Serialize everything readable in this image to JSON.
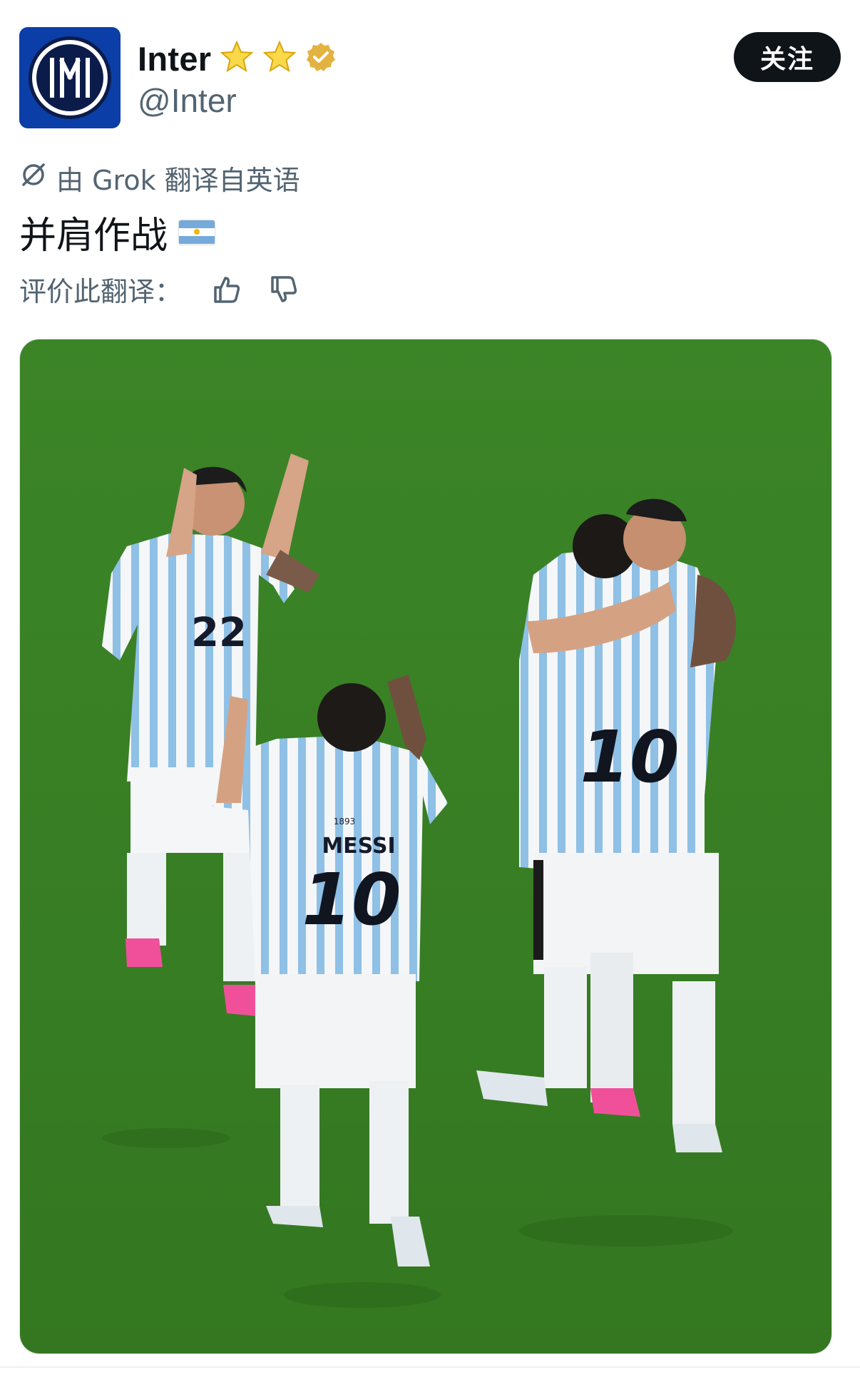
{
  "account": {
    "display_name": "Inter",
    "handle": "@Inter",
    "logo_letters": "IM",
    "badges": [
      "star-icon",
      "star-icon",
      "verified-badge-icon"
    ]
  },
  "follow_button": {
    "label": "关注"
  },
  "translation": {
    "label": "由 Grok 翻译自英语",
    "post_text": "并肩作战",
    "flag_emoji": "argentina-flag-icon",
    "rate_label": "评价此翻译："
  },
  "media": {
    "description_icon": "photo",
    "jersey_left": "22",
    "jersey_center_name": "MESSI",
    "jersey_center_number": "10",
    "jersey_right_number": "10",
    "jersey_year": "1893"
  },
  "colors": {
    "inter_blue": "#0c3ea7",
    "gold": "#f4c20d",
    "text_primary": "#0f1419",
    "text_secondary": "#536471",
    "follow_bg": "#0f1419",
    "argentina_blue": "#75aadb"
  }
}
